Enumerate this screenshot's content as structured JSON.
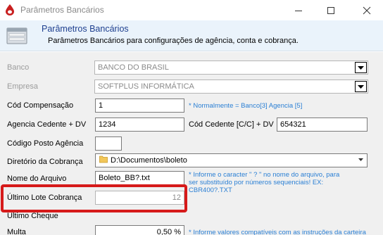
{
  "window": {
    "title": "Parâmetros Bancários"
  },
  "header": {
    "title": "Parâmetros Bancários",
    "subtitle": "Parâmetros Bancários para configurações de agência, conta e cobrança."
  },
  "form": {
    "banco": {
      "label": "Banco",
      "value": "BANCO DO BRASIL"
    },
    "empresa": {
      "label": "Empresa",
      "value": "SOFTPLUS INFORMÁTICA"
    },
    "cod_compensacao": {
      "label": "Cód Compensação",
      "value": "1",
      "note": "* Normalmente  = Banco[3] Agencia [5]"
    },
    "agencia_cedente": {
      "label": "Agencia Cedente + DV",
      "value": "1234"
    },
    "cod_cedente": {
      "label": "Cód Cedente [C/C] + DV",
      "value": "654321"
    },
    "codigo_posto": {
      "label": "Código Posto Agência",
      "value": ""
    },
    "diretorio": {
      "label": "Diretório da Cobrança",
      "value": "D:\\Documentos\\boleto"
    },
    "nome_arquivo": {
      "label": "Nome do Arquivo",
      "value": "Boleto_BB?.txt",
      "note_lines": [
        "* Informe o caracter \" ? \" no nome do arquivo, para",
        "ser substituído por números sequenciais! EX:",
        "CBR400?.TXT"
      ]
    },
    "ultimo_lote": {
      "label": "Último Lote Cobrança",
      "value": "12"
    },
    "ultimo_cheque": {
      "label": "Último Cheque",
      "value": ""
    },
    "multa": {
      "label": "Multa",
      "value": "0,50 %",
      "note": "* Informe valores compatíveis com as instruções da carteira"
    }
  },
  "colors": {
    "accent": "#1e3f8f",
    "note": "#2a7fd4",
    "highlight": "#d61a1a",
    "form_bg": "#f0f0f0"
  },
  "icons": [
    "app-logo-icon",
    "minimize-icon",
    "maximize-icon",
    "close-icon",
    "bank-params-icon",
    "dropdown-arrow-icon",
    "folder-icon"
  ]
}
